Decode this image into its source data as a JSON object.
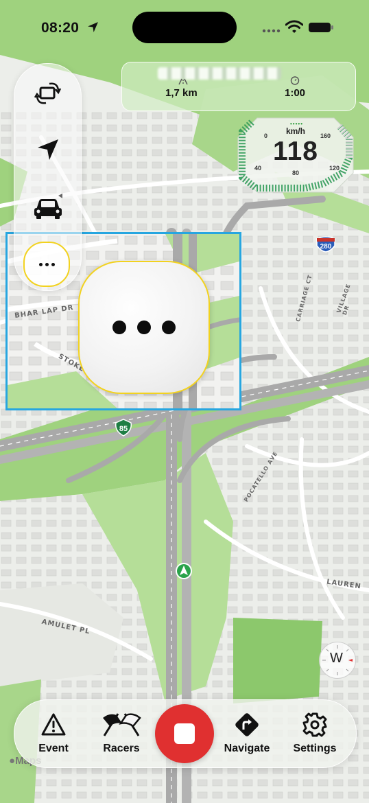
{
  "status_bar": {
    "time": "08:20"
  },
  "info_card": {
    "distance": "1,7 km",
    "timer": "1:00"
  },
  "speedometer": {
    "speed": "118",
    "unit": "km/h",
    "ticks": [
      "0",
      "40",
      "80",
      "120",
      "160"
    ]
  },
  "left_panel": {
    "buttons": [
      {
        "name": "rotate-screen-icon"
      },
      {
        "name": "location-arrow-icon"
      },
      {
        "name": "car-icon"
      },
      {
        "name": "more-icon"
      }
    ]
  },
  "map": {
    "shields": {
      "interstate": "280",
      "state_route": "85"
    },
    "street_labels": {
      "amulet": "AMULET PL",
      "lauren": "LAUREN",
      "pocatello": "POCATELLO AVE",
      "stokes": "STOKES LN",
      "bharlap": "BHAR LAP DR",
      "carriage": "CARRIAGE CT",
      "village": "VILLAGE DR"
    },
    "attribution": "Maps",
    "compass_letter": "W"
  },
  "toolbar": {
    "items": [
      {
        "label": "Event",
        "icon": "warning-icon"
      },
      {
        "label": "Racers",
        "icon": "racing-flags-icon"
      },
      {
        "label": "Navigate",
        "icon": "turn-right-sign-icon"
      },
      {
        "label": "Settings",
        "icon": "gear-icon"
      }
    ],
    "stop_icon": "stop-icon"
  },
  "colors": {
    "map_green": "#9fd27e",
    "highway": "#a9a9a9",
    "stop_red": "#e03030",
    "highlight_yellow": "#f2d21f",
    "frame_blue": "#27a6e0",
    "speed_green": "#2a9d3a"
  }
}
